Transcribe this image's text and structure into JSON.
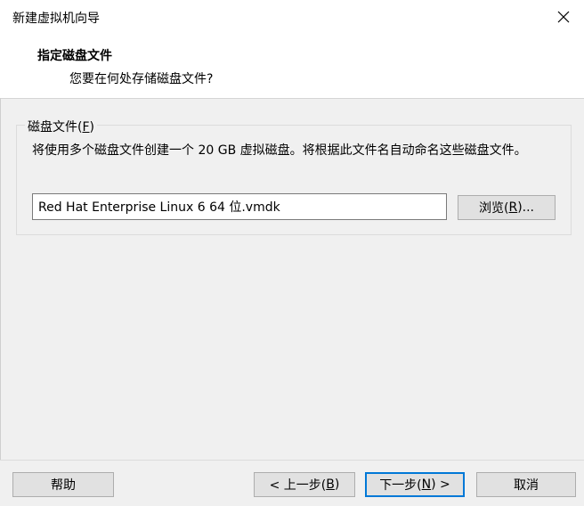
{
  "window": {
    "title": "新建虚拟机向导",
    "close_icon": "close-icon"
  },
  "header": {
    "heading": "指定磁盘文件",
    "subheading": "您要在何处存储磁盘文件?"
  },
  "disk_file_group": {
    "legend_prefix": "磁盘文件(",
    "legend_key": "F",
    "legend_suffix": ")",
    "description": "将使用多个磁盘文件创建一个 20 GB 虚拟磁盘。将根据此文件名自动命名这些磁盘文件。",
    "filename_value": "Red Hat Enterprise Linux 6 64 位.vmdk",
    "browse_label_prefix": "浏览(",
    "browse_label_key": "R",
    "browse_label_suffix": ")..."
  },
  "footer": {
    "help_label": "帮助",
    "back_prefix": "< 上一步(",
    "back_key": "B",
    "back_suffix": ")",
    "next_prefix": "下一步(",
    "next_key": "N",
    "next_suffix": ") >",
    "cancel_label": "取消"
  },
  "colors": {
    "accent": "#0078d7",
    "background": "#f0f0f0",
    "header_background": "#ffffff"
  }
}
